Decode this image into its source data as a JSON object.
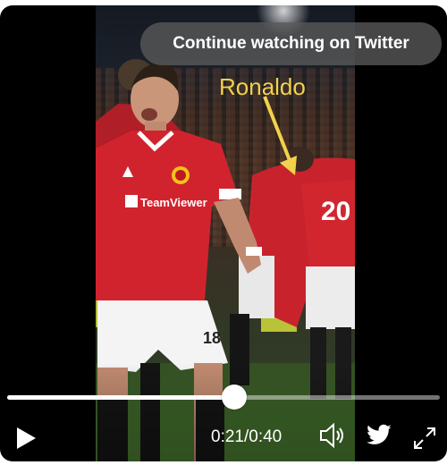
{
  "overlay": {
    "continue_label": "Continue watching on Twitter"
  },
  "annotation": {
    "label": "Ronaldo",
    "color": "#f2d24a"
  },
  "jersey": {
    "sponsor": "TeamViewer",
    "number": "18",
    "back_number": "20"
  },
  "playback": {
    "current_time": "0:21",
    "separator": "/",
    "duration": "0:40",
    "progress": 0.525
  },
  "icons": {
    "play": "play-icon",
    "volume": "volume-muted-icon",
    "brand": "twitter-bird-icon",
    "fullscreen": "expand-icon"
  },
  "colors": {
    "jersey_red": "#d1232e",
    "player_bg": "#000000",
    "accent": "#ffffff"
  }
}
